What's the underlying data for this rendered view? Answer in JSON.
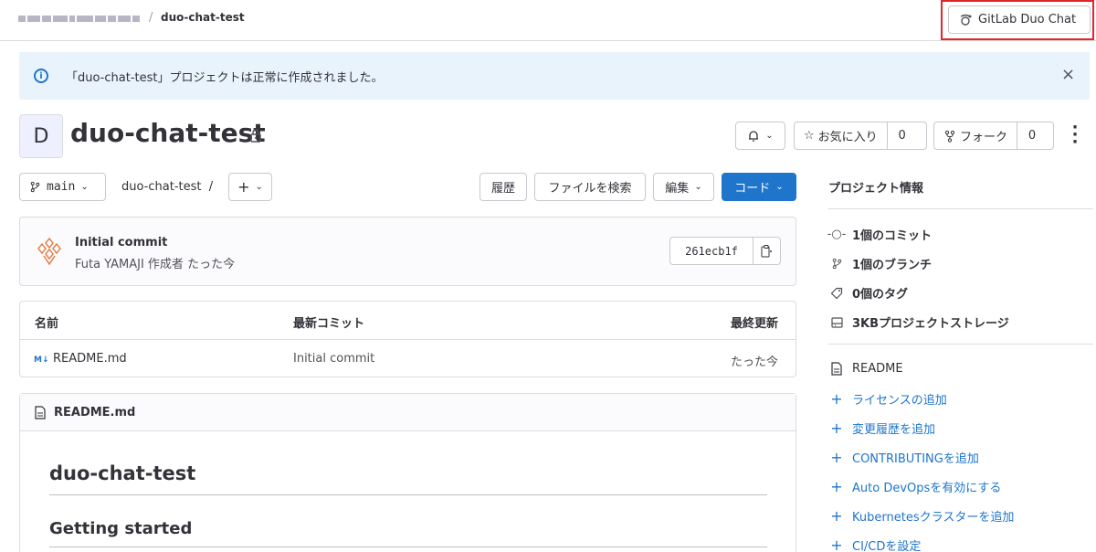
{
  "breadcrumb": {
    "separator": "/",
    "current": "duo-chat-test"
  },
  "header": {
    "duo_button_label": "GitLab Duo Chat"
  },
  "alert": {
    "message": "「duo-chat-test」プロジェクトは正常に作成されました。",
    "info_icon": "i",
    "close_icon": "×"
  },
  "project": {
    "avatar_letter": "D",
    "title": "duo-chat-test",
    "star_label": "お気に入り",
    "star_count": "0",
    "fork_label": "フォーク",
    "fork_count": "0"
  },
  "toolbar": {
    "branch": "main",
    "path": "duo-chat-test",
    "path_sep": "/",
    "plus": "+",
    "history": "履歴",
    "find_file": "ファイルを検索",
    "edit": "編集",
    "code": "コード"
  },
  "commit": {
    "title": "Initial commit",
    "meta": "Futa YAMAJI 作成者 たった今",
    "sha": "261ecb1f"
  },
  "files": {
    "headers": [
      "名前",
      "最新コミット",
      "最終更新"
    ],
    "rows": [
      {
        "icon": "M↓",
        "name": "README.md",
        "last_commit": "Initial commit",
        "updated": "たった今"
      }
    ]
  },
  "readme": {
    "filename": "README.md",
    "h1": "duo-chat-test",
    "h2": "Getting started"
  },
  "sidebar": {
    "title": "プロジェクト情報",
    "stats": [
      {
        "icon": "commit-icon",
        "label": "1個のコミット"
      },
      {
        "icon": "branch-icon",
        "label": "1個のブランチ"
      },
      {
        "icon": "tag-icon",
        "label": "0個のタグ"
      },
      {
        "icon": "storage-icon",
        "label": "3KBプロジェクトストレージ"
      }
    ],
    "readme_label": "README",
    "links": [
      "ライセンスの追加",
      "変更履歴を追加",
      "CONTRIBUTINGを追加",
      "Auto DevOpsを有効にする",
      "Kubernetesクラスターを追加",
      "CI/CDを設定"
    ]
  },
  "colors": {
    "accent": "#1f75cb",
    "alert_bg": "#e9f3fc",
    "highlight": "#e0262d"
  }
}
